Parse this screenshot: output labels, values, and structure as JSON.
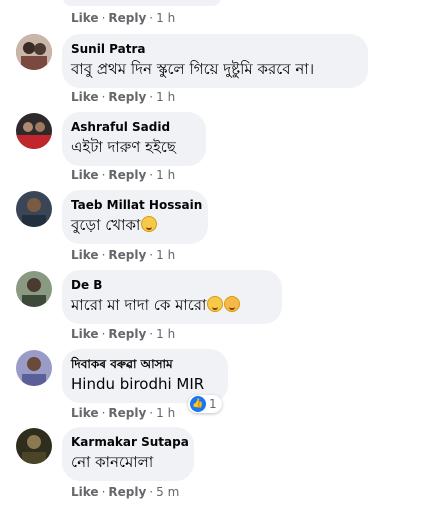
{
  "actions": {
    "like_label": "Like",
    "reply_label": "Reply",
    "separator": "·"
  },
  "top_item": {
    "time": "1 h"
  },
  "comments": [
    {
      "author": "Sunil Patra",
      "text": "বাবু প্রথম দিন স্কুলে গিয়ে দুষ্টুমি করবে না।",
      "time": "1 h",
      "avatar_color": "#8c6a5a"
    },
    {
      "author": "Ashraful Sadid",
      "text": "এইটা দারুণ হইছে",
      "time": "1 h",
      "avatar_color": "#3b2f2a"
    },
    {
      "author": "Taeb Millat Hossain",
      "text": "বুড়ো খোকা",
      "time": "1 h",
      "avatar_color": "#2b3a4a"
    },
    {
      "author": "De B",
      "text": "মারো মা দাদা কে মারো",
      "time": "1 h",
      "avatar_color": "#4f5b48"
    },
    {
      "author": "দিবাকৰ বৰুৱা আসাম",
      "text": "Hindu birodhi MIR",
      "time": "1 h",
      "avatar_color": "#6d6fa6",
      "reaction_count": "1"
    },
    {
      "author": "Karmakar Sutapa",
      "text": "নো কানমোলা",
      "time": "5 m",
      "avatar_color": "#3d3a26"
    }
  ],
  "colors": {
    "bubble": "#f0f2f5",
    "meta_text": "#65676b",
    "like_blue": "#1877f2"
  }
}
